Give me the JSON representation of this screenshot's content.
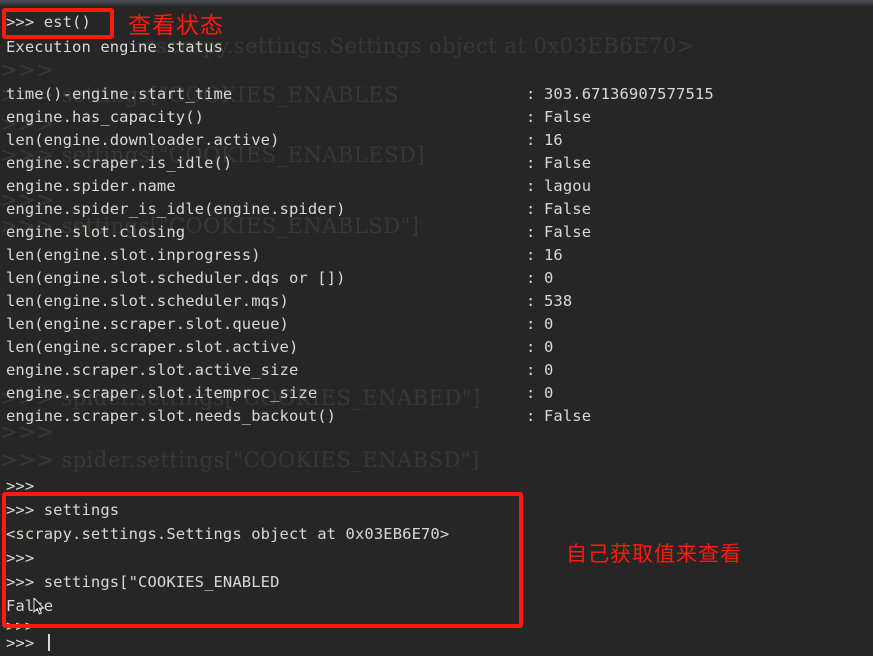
{
  "terminal": {
    "command_est": ">>> est()",
    "header": "Execution engine status",
    "blank": "",
    "colon": ":",
    "status_rows": [
      {
        "key": "time()-engine.start_time",
        "value": "303.67136907577515"
      },
      {
        "key": "engine.has_capacity()",
        "value": "False"
      },
      {
        "key": "len(engine.downloader.active)",
        "value": "16"
      },
      {
        "key": "engine.scraper.is_idle()",
        "value": "False"
      },
      {
        "key": "engine.spider.name",
        "value": "lagou"
      },
      {
        "key": "engine.spider_is_idle(engine.spider)",
        "value": "False"
      },
      {
        "key": "engine.slot.closing",
        "value": "False"
      },
      {
        "key": "len(engine.slot.inprogress)",
        "value": "16"
      },
      {
        "key": "len(engine.slot.scheduler.dqs or [])",
        "value": "0"
      },
      {
        "key": "len(engine.slot.scheduler.mqs)",
        "value": "538"
      },
      {
        "key": "len(engine.scraper.slot.queue)",
        "value": "0"
      },
      {
        "key": "len(engine.scraper.slot.active)",
        "value": "0"
      },
      {
        "key": "engine.scraper.slot.active_size",
        "value": "0"
      },
      {
        "key": "engine.scraper.slot.itemproc_size",
        "value": "0"
      },
      {
        "key": "engine.scraper.slot.needs_backout()",
        "value": "False"
      }
    ],
    "prompt_after_status": ">>>",
    "session_lines": [
      ">>> settings",
      "<scrapy.settings.Settings object at 0x03EB6E70>",
      ">>>",
      ">>> settings[\"COOKIES_ENABLED",
      "False",
      ">>>"
    ],
    "final_prompt": ">>>"
  },
  "ghost_text": {
    "lines": [
      "<scrapy.settings.Settings object at 0x03EB6E70>",
      ">>>",
      ">>> settings[\"COOKIES_ENABLES",
      ">>>",
      ">>> settings[\"COOKIES_ENABLESD]",
      ">>>",
      ">>> settings[\"COOKIES_ENABLSD\"]",
      ">>> spider.settings[\"COOKIES_ENABED\"]",
      ">>>",
      ">>> spider.settings[\"COOKIES_ENABSD\"]"
    ]
  },
  "annotations": {
    "top_label": "查看状态",
    "bottom_label": "自己获取值来查看"
  },
  "colors": {
    "background": "#262626",
    "text": "#d8d8d4",
    "annotation_red": "#fe1a0c",
    "ghost": "#3a3a38"
  }
}
